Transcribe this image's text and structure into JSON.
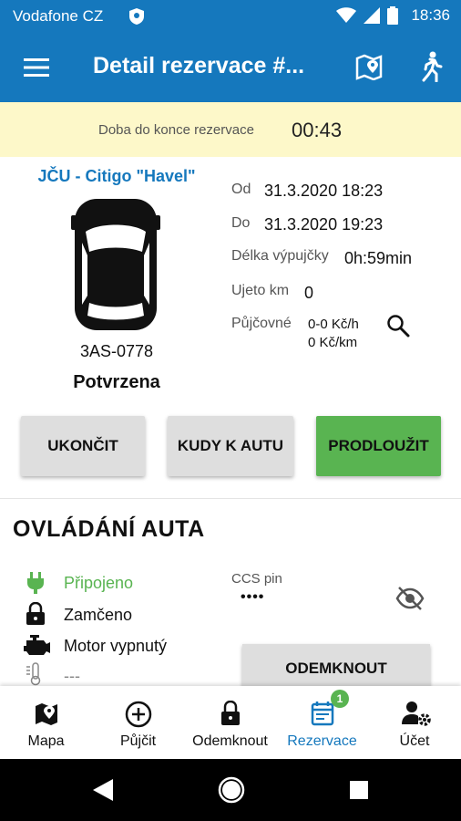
{
  "status_bar": {
    "carrier": "Vodafone CZ",
    "time": "18:36"
  },
  "app_bar": {
    "title": "Detail rezervace #..."
  },
  "timer": {
    "label": "Doba do konce rezervace",
    "value": "00:43"
  },
  "car": {
    "name": "JČU - Citigo \"Havel\"",
    "plate": "3AS-0778",
    "state": "Potvrzena"
  },
  "details": {
    "from_label": "Od",
    "from_value": "31.3.2020 18:23",
    "to_label": "Do",
    "to_value": "31.3.2020 19:23",
    "duration_label": "Délka výpujčky",
    "duration_value": "0h:59min",
    "km_label": "Ujeto km",
    "km_value": "0",
    "rent_label": "Půjčovné",
    "rent_hour": "0-0 Kč/h",
    "rent_km": "0 Kč/km"
  },
  "actions": {
    "end": "UKONČIT",
    "route": "KUDY K AUTU",
    "extend": "PRODLOUŽIT"
  },
  "control": {
    "title": "OVLÁDÁNÍ AUTA",
    "connected": "Připojeno",
    "locked": "Zamčeno",
    "engine": "Motor vypnutý",
    "temperature": "---",
    "ccs_label": "CCS pin",
    "ccs_value": "••••",
    "unlock": "ODEMKNOUT"
  },
  "nav": {
    "map": "Mapa",
    "rent": "Půjčit",
    "unlock": "Odemknout",
    "reservations": "Rezervace",
    "reservations_badge": "1",
    "account": "Účet"
  },
  "colors": {
    "primary": "#1578bd",
    "accent_green": "#59b451",
    "timer_bg": "#fdf8c9",
    "button_grey": "#dedede"
  },
  "icons": [
    "menu-icon",
    "map-icon",
    "walking-icon",
    "car-icon",
    "search-icon",
    "plug-icon",
    "lock-icon",
    "engine-icon",
    "thermometer-icon",
    "eye-off-icon",
    "plus-circle-icon",
    "calendar-icon",
    "account-settings-icon",
    "back-icon",
    "home-icon",
    "recents-icon"
  ]
}
